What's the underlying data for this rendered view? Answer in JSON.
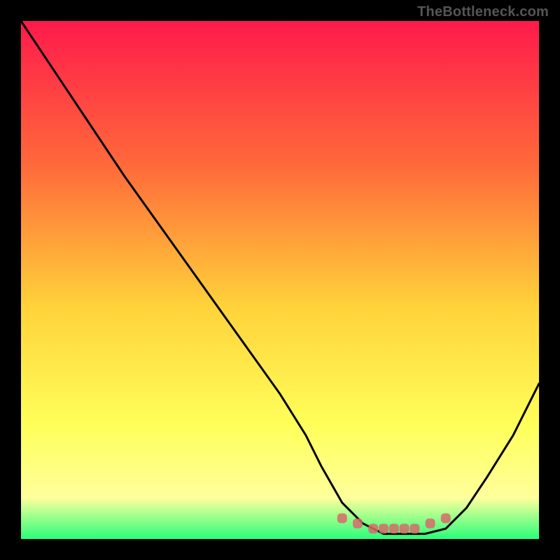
{
  "watermark": {
    "text": "TheBottleneck.com"
  },
  "chart_data": {
    "type": "line",
    "title": "",
    "xlabel": "",
    "ylabel": "",
    "xlim": [
      0,
      100
    ],
    "ylim": [
      0,
      100
    ],
    "grid": false,
    "legend": false,
    "background_gradient": {
      "top": "#ff1a4b",
      "mid1": "#ff7a3a",
      "mid2": "#ffe14a",
      "mid3": "#ffff9c",
      "bottom": "#2aff7a"
    },
    "series": [
      {
        "name": "bottleneck-curve",
        "x": [
          0,
          10,
          20,
          30,
          40,
          50,
          55,
          58,
          62,
          66,
          70,
          74,
          78,
          82,
          86,
          90,
          95,
          100
        ],
        "values": [
          100,
          85,
          70,
          56,
          42,
          28,
          20,
          14,
          7,
          3,
          1,
          1,
          1,
          2,
          6,
          12,
          20,
          30
        ]
      }
    ],
    "markers": {
      "name": "highlight-dots",
      "shape": "rounded-square",
      "color": "#d86a6a",
      "points": [
        {
          "x": 62,
          "y": 4
        },
        {
          "x": 65,
          "y": 3
        },
        {
          "x": 68,
          "y": 2
        },
        {
          "x": 70,
          "y": 2
        },
        {
          "x": 72,
          "y": 2
        },
        {
          "x": 74,
          "y": 2
        },
        {
          "x": 76,
          "y": 2
        },
        {
          "x": 79,
          "y": 3
        },
        {
          "x": 82,
          "y": 4
        }
      ]
    }
  }
}
